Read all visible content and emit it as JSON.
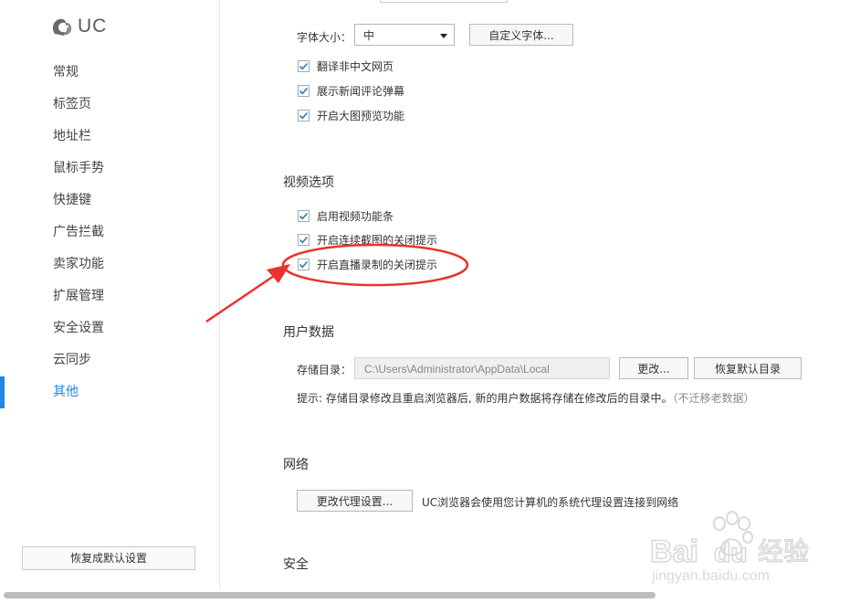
{
  "sidebar": {
    "logo_text": "UC",
    "items": [
      {
        "label": "常规"
      },
      {
        "label": "标签页"
      },
      {
        "label": "地址栏"
      },
      {
        "label": "鼠标手势"
      },
      {
        "label": "快捷键"
      },
      {
        "label": "广告拦截"
      },
      {
        "label": "卖家功能"
      },
      {
        "label": "扩展管理"
      },
      {
        "label": "安全设置"
      },
      {
        "label": "云同步"
      },
      {
        "label": "其他"
      }
    ],
    "active_item": "其他",
    "reset_label": "恢复成默认设置"
  },
  "web_content": {
    "font_size_label": "字体大小：",
    "font_size_value": "中",
    "custom_font_label": "自定义字体...",
    "options": [
      {
        "label": "翻译非中文网页",
        "checked": true
      },
      {
        "label": "展示新闻评论弹幕",
        "checked": true
      },
      {
        "label": "开启大图预览功能",
        "checked": true
      }
    ]
  },
  "video": {
    "heading": "视频选项",
    "options": [
      {
        "label": "启用视频功能条",
        "checked": true
      },
      {
        "label": "开启连续截图的关闭提示",
        "checked": true
      },
      {
        "label": "开启直播录制的关闭提示",
        "checked": true
      }
    ]
  },
  "user_data": {
    "heading": "用户数据",
    "storage_label": "存储目录：",
    "storage_path": "C:\\Users\\Administrator\\AppData\\Local",
    "change_label": "更改...",
    "restore_label": "恢复默认目录",
    "tip": "提示: 存储目录修改且重启浏览器后, 新的用户数据将存储在修改后的目录中。",
    "tip_note": "（不迁移老数据）"
  },
  "network": {
    "heading": "网络",
    "proxy_button": "更改代理设置...",
    "proxy_desc": "UC浏览器会使用您计算机的系统代理设置连接到网络"
  },
  "security": {
    "heading": "安全"
  },
  "watermark": {
    "brand": "Bai",
    "brand2": "du",
    "cn": "经验",
    "url": "jingyan.baidu.com"
  },
  "colors": {
    "accent": "#1e88e5",
    "annotation": "#e8342b"
  }
}
